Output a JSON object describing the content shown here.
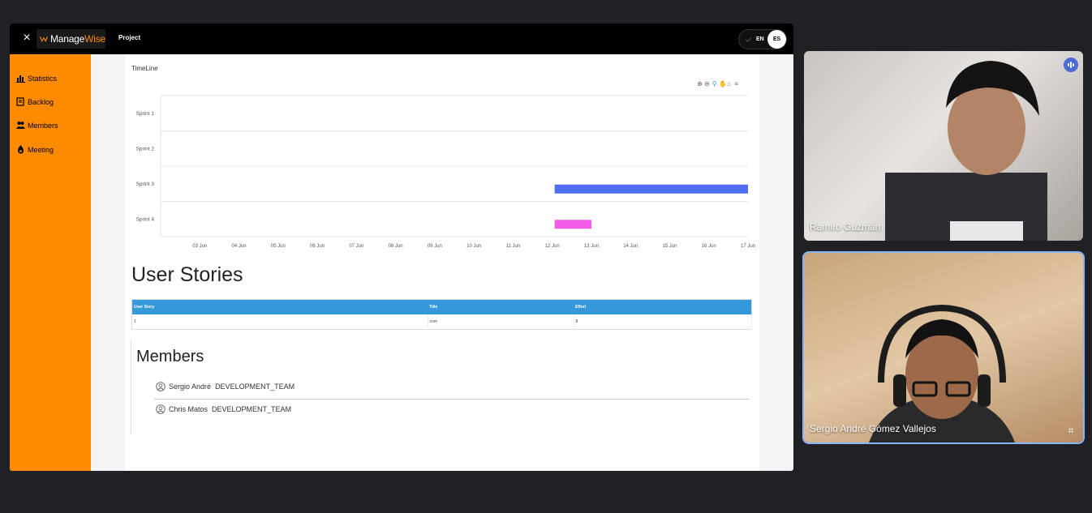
{
  "app": {
    "close_label": "×",
    "logo": {
      "part1": "Manage",
      "part2": "Wise"
    },
    "project_label": "Project",
    "lang": {
      "en": "EN",
      "es": "ES"
    }
  },
  "sidebar": {
    "items": [
      {
        "label": "Statistics",
        "icon": "chart-icon"
      },
      {
        "label": "Backlog",
        "icon": "backlog-icon"
      },
      {
        "label": "Members",
        "icon": "members-icon"
      },
      {
        "label": "Meeting",
        "icon": "meeting-icon"
      }
    ]
  },
  "timeline": {
    "title": "TimeLine",
    "toolbar_icons": [
      "zoom-in-icon",
      "zoom-out-icon",
      "search-icon",
      "pan-icon",
      "home-icon",
      "menu-icon"
    ]
  },
  "chart_data": {
    "type": "bar",
    "categories": [
      "Sprint 1",
      "Sprint 2",
      "Sprint 3",
      "Sprint 4"
    ],
    "x_ticks": [
      "03 Jun",
      "04 Jun",
      "05 Jun",
      "06 Jun",
      "07 Jun",
      "08 Jun",
      "09 Jun",
      "10 Jun",
      "11 Jun",
      "12 Jun",
      "13 Jun",
      "14 Jun",
      "15 Jun",
      "16 Jun",
      "17 Jun"
    ],
    "xlim": [
      "2023-06-02",
      "2023-06-17"
    ],
    "ranges": [
      {
        "category": "Sprint 3",
        "start": "2023-06-12",
        "end": "2023-06-17",
        "color": "#4f6ef2"
      },
      {
        "category": "Sprint 4",
        "start": "2023-06-12",
        "end": "2023-06-13",
        "color": "#f25ce6"
      }
    ],
    "grid": true
  },
  "user_stories": {
    "title": "User Stories",
    "columns": [
      "User Story",
      "Title",
      "Effort"
    ],
    "rows": [
      [
        "1",
        "com",
        "8"
      ]
    ]
  },
  "members": {
    "title": "Members",
    "list": [
      {
        "name": "Sergio André",
        "role": "DEVELOPMENT_TEAM"
      },
      {
        "name": "Chris Matos",
        "role": "DEVELOPMENT_TEAM"
      }
    ]
  },
  "video": {
    "tiles": [
      {
        "name": "Ramiro Guzmán"
      },
      {
        "name": "Sergio André Gómez Vallejos"
      }
    ]
  }
}
